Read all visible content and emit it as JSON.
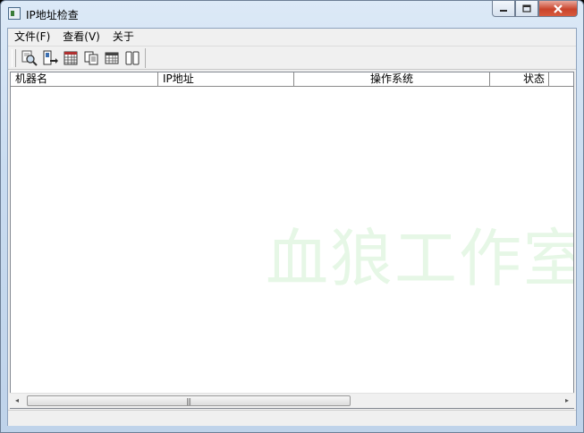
{
  "window": {
    "title": "IP地址检查",
    "minimize_label": "▭",
    "maximize_label": "▢",
    "close_label": "✕"
  },
  "menu": {
    "items": [
      {
        "label": "文件(F)"
      },
      {
        "label": "查看(V)"
      },
      {
        "label": "关于"
      }
    ]
  },
  "toolbar": {
    "buttons": [
      {
        "icon": "magnifier-scan-icon"
      },
      {
        "icon": "export-arrow-icon"
      },
      {
        "icon": "grid-table-icon"
      },
      {
        "icon": "copy-pages-icon"
      },
      {
        "icon": "columns-grid-icon"
      },
      {
        "icon": "split-panes-icon"
      }
    ]
  },
  "list": {
    "columns": [
      {
        "label": "机器名"
      },
      {
        "label": "IP地址"
      },
      {
        "label": "操作系统"
      },
      {
        "label": "状态"
      }
    ],
    "rows": []
  },
  "watermark": "血狼工作室",
  "scrollbar": {
    "left_arrow": "◂",
    "right_arrow": "▸",
    "grip": "|||"
  },
  "colors": {
    "watermark": "#e6f7e6",
    "close_button": "#c9442c",
    "list_background": "#ffffff"
  }
}
